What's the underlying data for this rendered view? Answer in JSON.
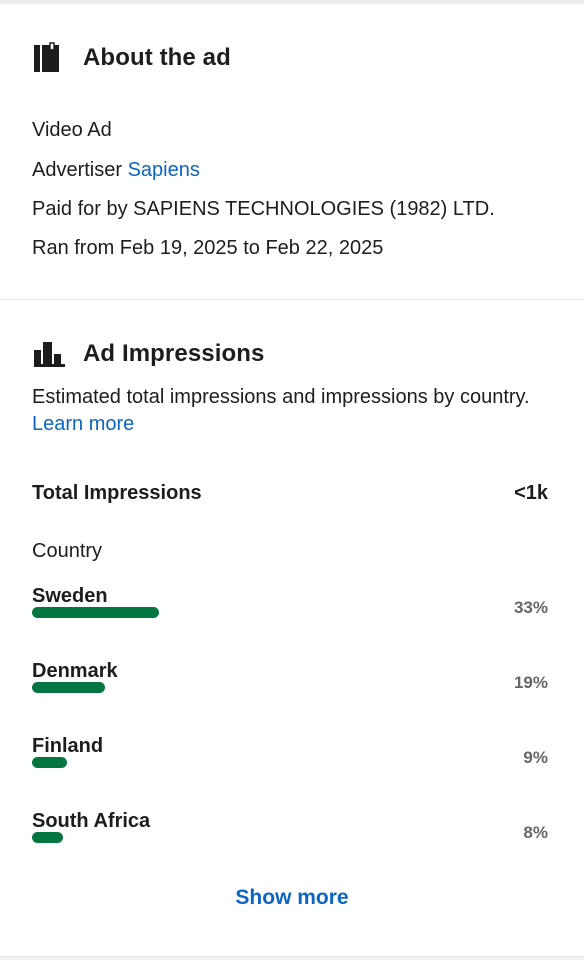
{
  "about": {
    "title": "About the ad",
    "icon": "book-icon",
    "ad_type": "Video Ad",
    "advertiser_prefix": "Advertiser",
    "advertiser_name": "Sapiens",
    "paid_for": "Paid for by SAPIENS TECHNOLOGIES (1982) LTD.",
    "ran": "Ran from Feb 19, 2025 to Feb 22, 2025"
  },
  "impressions": {
    "title": "Ad Impressions",
    "icon": "bar-chart-icon",
    "description": "Estimated total impressions and impressions by country.",
    "learn_more": "Learn more",
    "total_label": "Total Impressions",
    "total_value": "<1k",
    "country_label": "Country",
    "countries": [
      {
        "name": "Sweden",
        "percent_text": "33%",
        "percent": 33
      },
      {
        "name": "Denmark",
        "percent_text": "19%",
        "percent": 19
      },
      {
        "name": "Finland",
        "percent_text": "9%",
        "percent": 9
      },
      {
        "name": "South Africa",
        "percent_text": "8%",
        "percent": 8
      }
    ],
    "show_more": "Show more"
  },
  "colors": {
    "accent_link": "#0a66c2",
    "bar_fill": "#057642",
    "percent_text": "#666666"
  }
}
